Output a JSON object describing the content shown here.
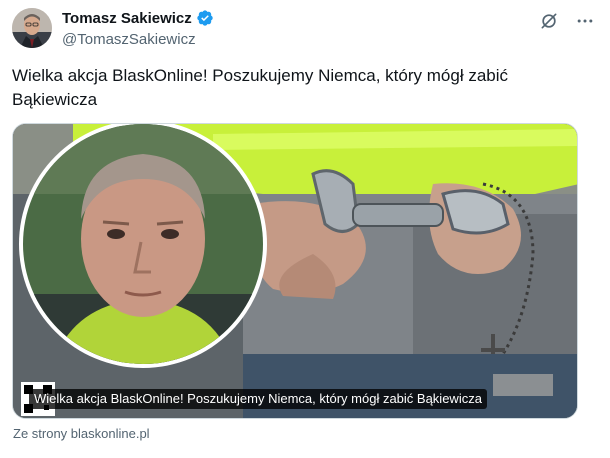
{
  "author": {
    "display_name": "Tomasz Sakiewicz",
    "handle": "@TomaszSakiewicz",
    "verified": true
  },
  "icons": {
    "verified": "verified-badge-icon",
    "grok": "grok-icon",
    "more": "more-icon"
  },
  "tweet": {
    "text": "Wielka akcja BlaskOnline! Poszukujemy Niemca, który mógł zabić Bąkiewicza"
  },
  "card": {
    "caption": "Wielka akcja BlaskOnline! Poszukujemy Niemca, który mógł zabić Bąkiewicza",
    "source": "Ze strony blaskonline.pl"
  },
  "colors": {
    "verified_blue": "#1d9bf0",
    "secondary_text": "#536471",
    "hi_vis_yellow": "#c8f03a"
  }
}
